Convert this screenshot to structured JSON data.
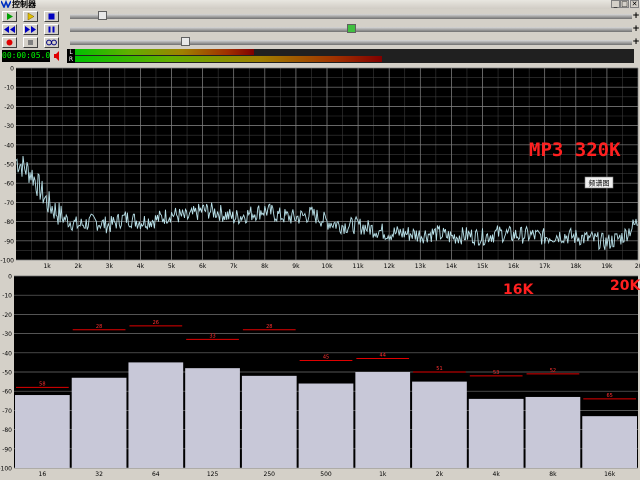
{
  "window": {
    "title": "控制器",
    "min_label": "_",
    "max_label": "□",
    "close_label": "✕"
  },
  "controls": {
    "time": "00:00:05.0",
    "meter_left_label": "L",
    "meter_right_label": "R",
    "position_level": 0.05,
    "balance_level": 0.5,
    "volume_level": 0.2,
    "meter_left_level": 0.32,
    "meter_right_level": 0.55,
    "plus_label": "+",
    "slider_marks": [
      "◈",
      "◉",
      "⊘"
    ]
  },
  "colors": {
    "play": "#00a000",
    "stop": "#0000c0",
    "record": "#e00000",
    "annotation": "#ff2020",
    "trace": "#b8e0e8",
    "bar_fill": "#c8c8d8"
  },
  "annotations": {
    "top_label": "MP3 320K",
    "tooltip": "频谱图",
    "label_16k": "16K",
    "label_20k": "20K"
  },
  "chart_data": [
    {
      "type": "line",
      "x_ticks": [
        "1k",
        "2k",
        "3k",
        "4k",
        "5k",
        "6k",
        "7k",
        "8k",
        "9k",
        "10k",
        "11k",
        "12k",
        "13k",
        "14k",
        "15k",
        "16k",
        "17k",
        "18k",
        "19k",
        "2("
      ],
      "y_ticks": [
        "0",
        "-10",
        "-20",
        "-30",
        "-40",
        "-50",
        "-60",
        "-70",
        "-80",
        "-90",
        "-100"
      ],
      "xlim": [
        0,
        20000
      ],
      "ylim": [
        -100,
        0
      ],
      "grid": true,
      "series": [
        {
          "x": [
            0,
            500,
            1000,
            1500,
            2000,
            2500,
            3000,
            3500,
            4000,
            4500,
            5000,
            5500,
            6000,
            6500,
            7000,
            7500,
            8000,
            8500,
            9000,
            9500,
            10000,
            10500,
            11000,
            11500,
            12000,
            12500,
            13000,
            13500,
            14000,
            14500,
            15000,
            15500,
            16000,
            16500,
            17000,
            17500,
            18000,
            18500,
            19000,
            19500,
            20000
          ],
          "y": [
            -48,
            -55,
            -70,
            -78,
            -82,
            -80,
            -82,
            -78,
            -80,
            -79,
            -76,
            -78,
            -74,
            -75,
            -78,
            -76,
            -74,
            -77,
            -78,
            -76,
            -80,
            -82,
            -82,
            -84,
            -86,
            -86,
            -87,
            -86,
            -88,
            -87,
            -88,
            -86,
            -87,
            -87,
            -88,
            -87,
            -88,
            -89,
            -91,
            -88,
            -80
          ]
        }
      ]
    },
    {
      "type": "bar",
      "categories": [
        "16",
        "32",
        "64",
        "125",
        "250",
        "500",
        "1k",
        "2k",
        "4k",
        "8k",
        "16k"
      ],
      "values": [
        -62,
        -53,
        -45,
        -48,
        -52,
        -56,
        -50,
        -55,
        -64,
        -63,
        -73
      ],
      "peak_values": [
        -58,
        -28,
        -26,
        -33,
        -28,
        -44,
        -43,
        -50,
        -52,
        -51,
        -64
      ],
      "peak_labels": [
        "58",
        "28",
        "26",
        "33",
        "28",
        "45",
        "44",
        "51",
        "53",
        "52",
        "65"
      ],
      "y_ticks": [
        "0",
        "-10",
        "-20",
        "-30",
        "-40",
        "-50",
        "-60",
        "-70",
        "-80",
        "-90",
        "-100"
      ],
      "ylim": [
        -100,
        0
      ],
      "grid": true
    }
  ]
}
